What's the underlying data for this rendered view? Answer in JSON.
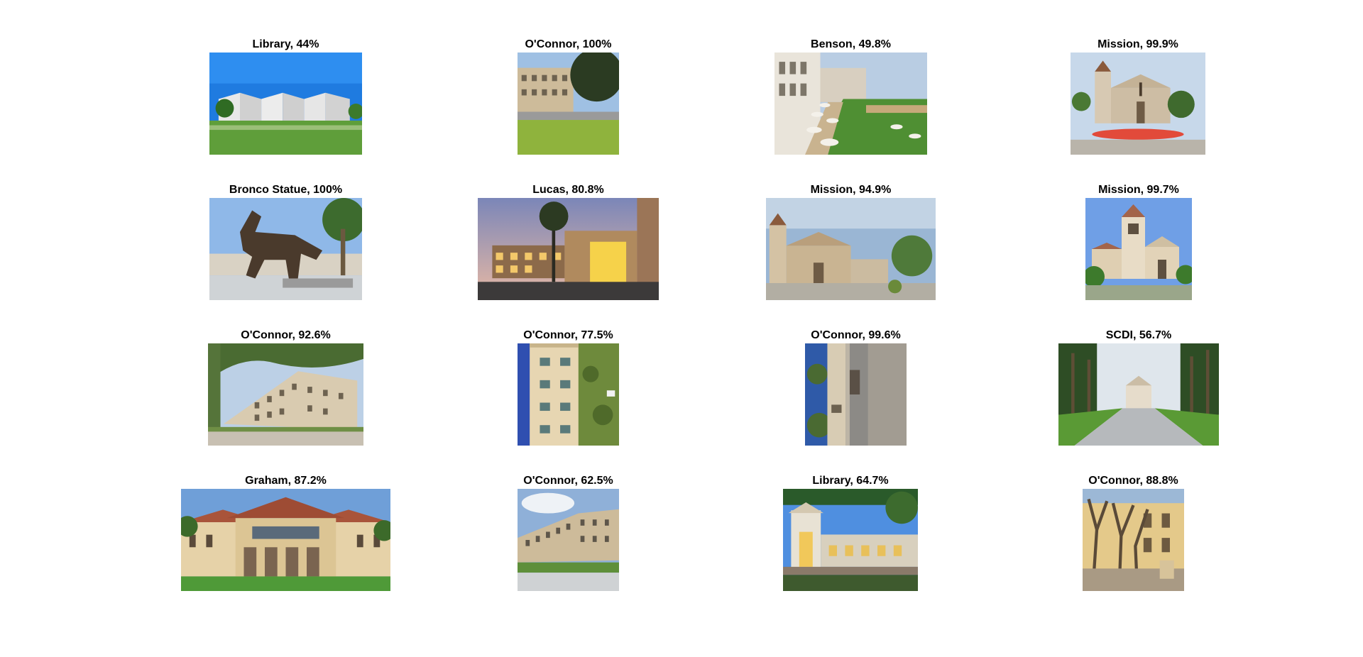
{
  "tiles": [
    {
      "title": "Library, 44%",
      "scene": "library-building-photo"
    },
    {
      "title": "O'Connor, 100%",
      "scene": "oconnor-hall-photo"
    },
    {
      "title": "Benson, 49.8%",
      "scene": "benson-center-patio-photo"
    },
    {
      "title": "Mission, 99.9%",
      "scene": "mission-church-photo"
    },
    {
      "title": "Bronco Statue, 100%",
      "scene": "bronco-statue-photo"
    },
    {
      "title": "Lucas, 80.8%",
      "scene": "lucas-hall-dusk-photo"
    },
    {
      "title": "Mission, 94.9%",
      "scene": "mission-church-wide-photo"
    },
    {
      "title": "Mission, 99.7%",
      "scene": "mission-church-tower-photo"
    },
    {
      "title": "O'Connor, 92.6%",
      "scene": "oconnor-hall-trees-photo"
    },
    {
      "title": "O'Connor, 77.5%",
      "scene": "oconnor-hall-rotated-photo"
    },
    {
      "title": "O'Connor, 99.6%",
      "scene": "oconnor-hall-rotated-wall-photo"
    },
    {
      "title": "SCDI, 56.7%",
      "scene": "palm-walkway-mission-photo"
    },
    {
      "title": "Graham, 87.2%",
      "scene": "graham-hall-photo"
    },
    {
      "title": "O'Connor, 62.5%",
      "scene": "oconnor-hall-side-photo"
    },
    {
      "title": "Library, 64.7%",
      "scene": "library-entrance-photo"
    },
    {
      "title": "O'Connor, 88.8%",
      "scene": "oconnor-hall-bare-trees-photo"
    }
  ]
}
